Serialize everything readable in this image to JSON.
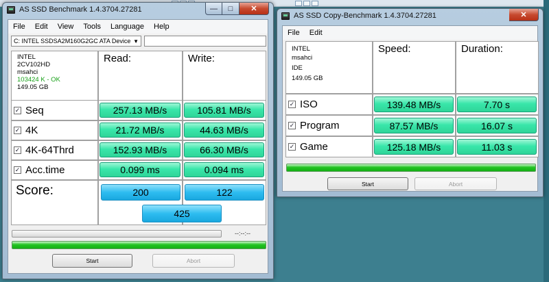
{
  "bench": {
    "title": "AS SSD Benchmark 1.4.3704.27281",
    "menu": [
      "File",
      "Edit",
      "View",
      "Tools",
      "Language",
      "Help"
    ],
    "device_select": "C: INTEL SSDSA2M160G2GC ATA Device",
    "path_value": "",
    "info": [
      "INTEL",
      "2CV102HD",
      "msahci",
      "103424 K - OK",
      "149.05 GB"
    ],
    "headers": {
      "read": "Read:",
      "write": "Write:"
    },
    "rows": [
      {
        "label": "Seq",
        "read": "257.13 MB/s",
        "write": "105.81 MB/s"
      },
      {
        "label": "4K",
        "read": "21.72 MB/s",
        "write": "44.63 MB/s"
      },
      {
        "label": "4K-64Thrd",
        "read": "152.93 MB/s",
        "write": "66.30 MB/s"
      },
      {
        "label": "Acc.time",
        "read": "0.099 ms",
        "write": "0.094 ms"
      }
    ],
    "score": {
      "label": "Score:",
      "read": "200",
      "write": "122",
      "total": "425"
    },
    "progress_time": "--:--:--",
    "progress": 1.0,
    "start_label": "Start",
    "abort_label": "Abort"
  },
  "copy": {
    "title": "AS SSD Copy-Benchmark 1.4.3704.27281",
    "menu": [
      "File",
      "Edit"
    ],
    "info": [
      "INTEL",
      "msahci",
      "IDE",
      "149.05 GB"
    ],
    "headers": {
      "speed": "Speed:",
      "duration": "Duration:"
    },
    "rows": [
      {
        "label": "ISO",
        "speed": "139.48 MB/s",
        "duration": "7.70 s"
      },
      {
        "label": "Program",
        "speed": "87.57 MB/s",
        "duration": "16.07 s"
      },
      {
        "label": "Game",
        "speed": "125.18 MB/s",
        "duration": "11.03 s"
      }
    ],
    "progress": 1.0,
    "start_label": "Start",
    "abort_label": "Abort"
  },
  "window_controls": {
    "minimize": "—",
    "maximize": "□",
    "close": "✕"
  },
  "checkbox_mark": "✓",
  "colors": {
    "result_green": "#39e6aa",
    "score_blue": "#2ebcf0",
    "progress_green": "#22c322",
    "ok_text": "#18a018"
  }
}
